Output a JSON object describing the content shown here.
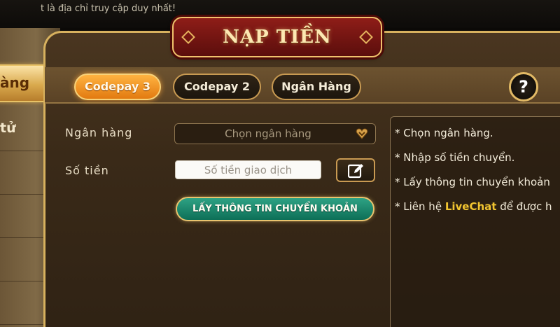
{
  "marquee": {
    "text": "t là địa chỉ truy cập duy nhất!"
  },
  "title": "NẠP TIỀN",
  "sidebar": {
    "items": [
      {
        "label": "àng",
        "active": true
      },
      {
        "label": "tử",
        "active": false
      }
    ]
  },
  "tabs": [
    {
      "label": "Codepay 3",
      "active": true
    },
    {
      "label": "Codepay 2",
      "active": false
    },
    {
      "label": "Ngân Hàng",
      "active": false
    }
  ],
  "help_button": {
    "label": "?"
  },
  "form": {
    "bank_label": "Ngân hàng",
    "bank_select_value": "Chọn ngân hàng",
    "amount_label": "Số tiền",
    "amount_placeholder": "Số tiền giao dịch",
    "amount_value": "",
    "submit_label": "LẤY THÔNG TIN CHUYỂN KHOẢN"
  },
  "instructions": {
    "items": [
      {
        "bullet": "*",
        "text": "Chọn ngân hàng."
      },
      {
        "bullet": "*",
        "text": "Nhập số tiền chuyển."
      },
      {
        "bullet": "*",
        "text": "Lấy thông tin chuyển khoản"
      },
      {
        "bullet": "*",
        "prefix": "Liên hệ ",
        "highlight": "LiveChat",
        "suffix": " để được h"
      }
    ]
  },
  "colors": {
    "active_tab": "#e27a10",
    "submit_button": "#0d6f57",
    "title_plate": "#8e1d18",
    "gold_border": "#d7b15e",
    "livechat_highlight": "#f2c530"
  },
  "icons": {
    "select": "heart-chevron-icon",
    "edit": "edit-pencil-icon",
    "help": "question-icon"
  }
}
